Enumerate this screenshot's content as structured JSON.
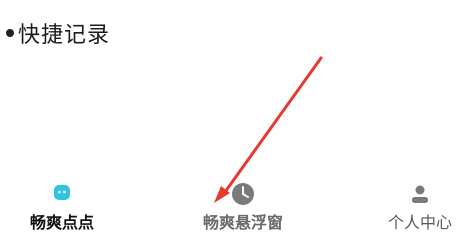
{
  "note": {
    "text": "快捷记录"
  },
  "tabbar": {
    "tabs": [
      {
        "label": "畅爽点点",
        "icon": "mascot-icon",
        "active": true
      },
      {
        "label": "畅爽悬浮窗",
        "icon": "clock-icon",
        "active": false
      },
      {
        "label": "个人中心",
        "icon": "person-icon",
        "active": false
      }
    ]
  },
  "colors": {
    "accent": "#2ec4e0",
    "annotation_arrow": "#e53a2f",
    "inactive_icon": "#7a7a7a"
  }
}
